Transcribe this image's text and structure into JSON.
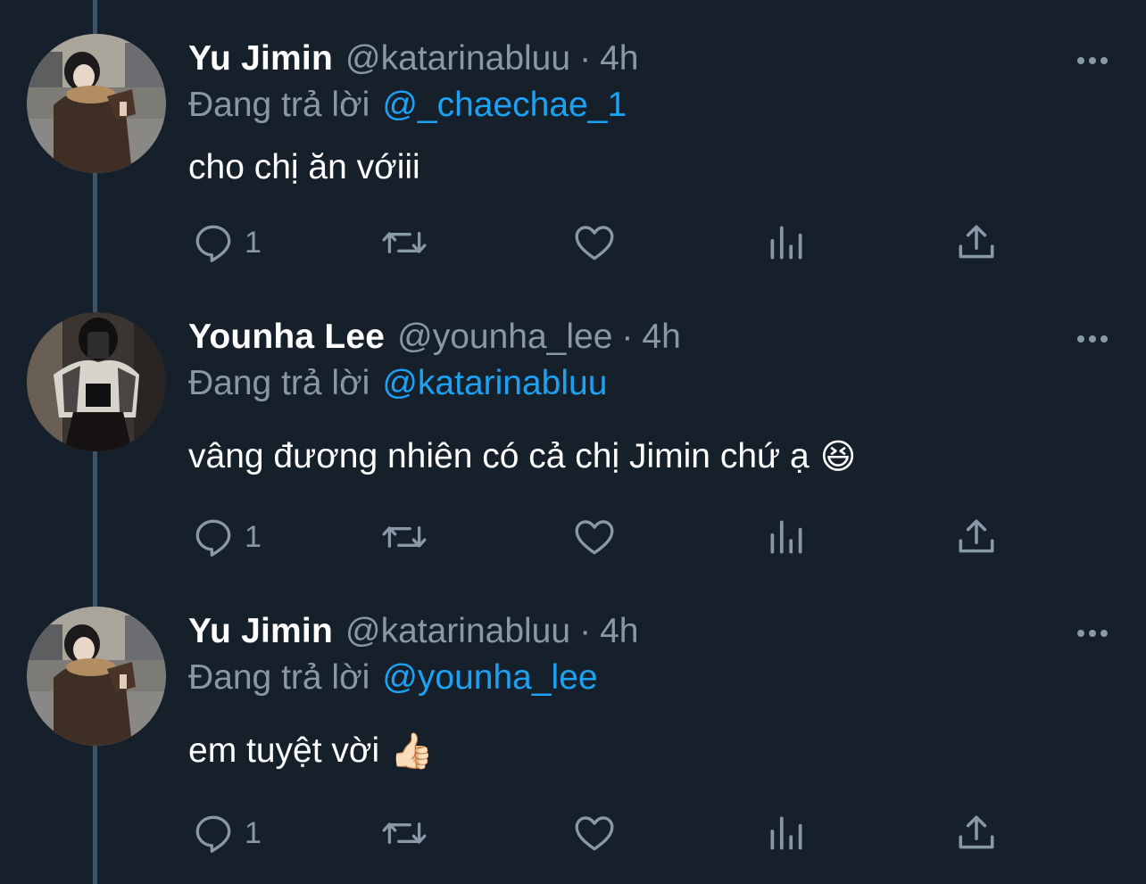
{
  "tweets": [
    {
      "name": "Yu Jimin",
      "handle": "@katarinabluu",
      "separator": "·",
      "time": "4h",
      "reply_prefix": "Đang trả lời",
      "reply_to": "@_chaechae_1",
      "text": "cho chị ăn vớiii",
      "emoji": "",
      "reply_count": "1",
      "avatar": "avatar-yu-jimin"
    },
    {
      "name": "Younha Lee",
      "handle": "@younha_lee",
      "separator": "·",
      "time": "4h",
      "reply_prefix": "Đang trả lời",
      "reply_to": "@katarinabluu",
      "text": "vâng đương nhiên có cả chị Jimin chứ ạ",
      "emoji": "😆",
      "reply_count": "1",
      "avatar": "avatar-younha-lee"
    },
    {
      "name": "Yu Jimin",
      "handle": "@katarinabluu",
      "separator": "·",
      "time": "4h",
      "reply_prefix": "Đang trả lời",
      "reply_to": "@younha_lee",
      "text": "em tuyệt vời",
      "emoji": "👍🏻",
      "reply_count": "1",
      "avatar": "avatar-yu-jimin"
    }
  ],
  "icons": {
    "more": "more-icon",
    "reply": "reply-icon",
    "retweet": "retweet-icon",
    "like": "heart-icon",
    "analytics": "analytics-icon",
    "share": "share-icon"
  },
  "colors": {
    "background": "#15202b",
    "muted": "#8899a6",
    "link": "#1da1f2",
    "thread_line": "#3d5466"
  }
}
